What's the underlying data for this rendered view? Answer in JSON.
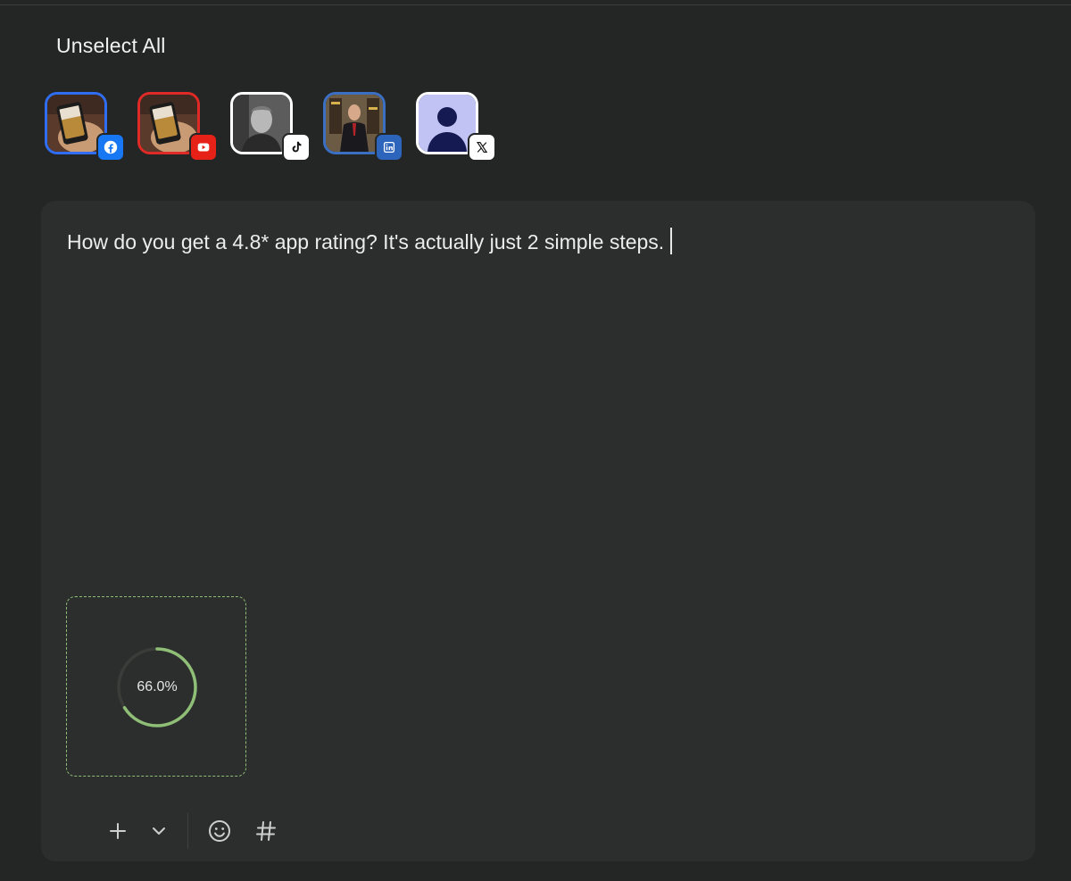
{
  "header": {
    "unselect_all_label": "Unselect All"
  },
  "accounts": [
    {
      "platform": "facebook",
      "avatar": "phone-in-hand-photo",
      "icon": "facebook-icon",
      "border_color": "#2f6df2",
      "badge_color": "#1877f2",
      "selected": true
    },
    {
      "platform": "youtube",
      "avatar": "phone-in-hand-photo",
      "icon": "youtube-icon",
      "border_color": "#e02a27",
      "badge_color": "#e62117",
      "selected": true
    },
    {
      "platform": "tiktok",
      "avatar": "man-portrait-photo",
      "icon": "tiktok-icon",
      "border_color": "#ffffff",
      "badge_color": "#ffffff",
      "selected": true
    },
    {
      "platform": "linkedin",
      "avatar": "man-in-suit-photo",
      "icon": "linkedin-icon",
      "border_color": "#3b6fc2",
      "badge_color": "#2d64bc",
      "selected": true
    },
    {
      "platform": "x",
      "avatar": "default-user-avatar",
      "icon": "x-icon",
      "border_color": "#ffffff",
      "badge_color": "#ffffff",
      "selected": true
    }
  ],
  "composer": {
    "text": "How do you get a 4.8* app rating? It's actually just 2 simple steps.",
    "upload": {
      "progress_fraction": 0.66,
      "progress_label": "66.0%",
      "accent": "#8fbf77"
    },
    "toolbar": [
      "add-icon",
      "chevron-down-icon",
      "emoji-icon",
      "hashtag-icon"
    ]
  }
}
